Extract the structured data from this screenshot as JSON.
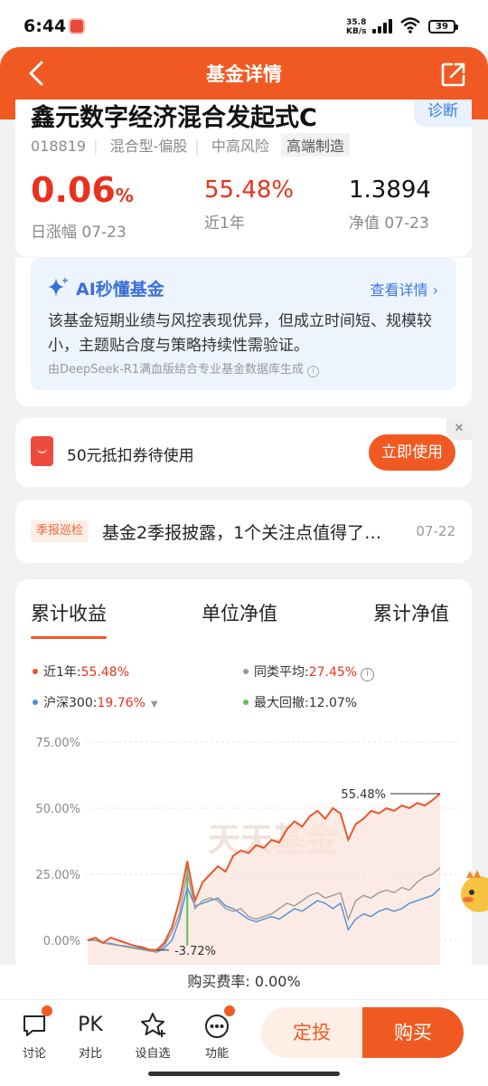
{
  "status_bar": {
    "time": "6:44",
    "net_speed": "35.8",
    "net_unit": "KB/s",
    "battery": "39"
  },
  "header": {
    "title": "基金详情"
  },
  "fund": {
    "name": "鑫元数字经济混合发起式C",
    "diagnose_label": "诊断",
    "code": "018819",
    "type": "混合型-偏股",
    "risk": "中高风险",
    "theme": "高端制造",
    "daily_change": "0.06",
    "daily_change_unit": "%",
    "daily_label": "日涨幅 07-23",
    "year_return": "55.48%",
    "year_label": "近1年",
    "nav": "1.3894",
    "nav_label": "净值 07-23"
  },
  "ai": {
    "title": "AI秒懂基金",
    "link": "查看详情",
    "text": "该基金短期业绩与风控表现优异，但成立时间短、规模较小，主题贴合度与策略持续性需验证。",
    "source": "由DeepSeek-R1满血版结合专业基金数据库生成"
  },
  "coupon": {
    "text": "50元抵扣券待使用",
    "button": "立即使用",
    "close": "✕"
  },
  "news": {
    "tag": "季报巡检",
    "title": "基金2季报披露，1个关注点值得了…",
    "date": "07-22"
  },
  "chart_tabs": [
    "累计收益",
    "单位净值",
    "累计净值"
  ],
  "legend": {
    "fund_label": "近1年:",
    "fund_value": "55.48%",
    "peer_label": "同类平均:",
    "peer_value": "27.45%",
    "index_label": "沪深300:",
    "index_value": "19.76%",
    "drawdown_label": "最大回撤:",
    "drawdown_value": "12.07%"
  },
  "colors": {
    "fund": "#e8562a",
    "peer": "#999999",
    "index": "#4a8fe0",
    "drawdown": "#5cc15a",
    "accent": "#f05a22"
  },
  "chart_data": {
    "type": "line",
    "y_ticks": [
      "75.00%",
      "50.00%",
      "25.00%",
      "0.00%"
    ],
    "ylim": [
      -10,
      75
    ],
    "watermark": "天天基金",
    "annotations": {
      "max": "55.48%",
      "min": "-3.72%"
    },
    "series": [
      {
        "name": "近1年",
        "values": [
          0,
          1,
          -1,
          1,
          0,
          -1,
          -2,
          -2.5,
          -3.5,
          -3.7,
          -1,
          5,
          15,
          30,
          15,
          22,
          25,
          28,
          26,
          32,
          34,
          33,
          36,
          35,
          38,
          37,
          42,
          45,
          43,
          47,
          49,
          46,
          50,
          48,
          38,
          44,
          46,
          49,
          48,
          50,
          49,
          51,
          50,
          52,
          51,
          53,
          55.5
        ]
      },
      {
        "name": "同类平均",
        "values": [
          0,
          0,
          -1,
          -1.5,
          -2,
          -2.5,
          -3,
          -3.5,
          -4,
          -4.5,
          -2,
          3,
          10,
          26,
          12,
          15,
          16,
          15,
          12,
          11,
          12,
          9,
          8,
          9,
          10,
          12,
          14,
          13,
          15,
          17,
          18,
          16,
          17,
          18,
          8,
          15,
          17,
          16,
          18,
          19,
          18,
          20,
          19,
          22,
          24,
          25,
          27.45
        ]
      },
      {
        "name": "沪深300",
        "values": [
          0,
          0,
          -1,
          -1.2,
          -1.8,
          -2.2,
          -2.8,
          -3,
          -3.8,
          -4.5,
          -3,
          0,
          8,
          20,
          13,
          14,
          15,
          16,
          13,
          12,
          10,
          8,
          7,
          8,
          9,
          8,
          10,
          12,
          11,
          13,
          15,
          14,
          12,
          14,
          4,
          8,
          10,
          9,
          11,
          12,
          11,
          12,
          14,
          15,
          16,
          17,
          19.76
        ]
      }
    ]
  },
  "fee": "购买费率: 0.00%",
  "bottom_nav": [
    "讨论",
    "对比",
    "设自选",
    "功能"
  ],
  "bottom_pk": "PK",
  "actions": {
    "dingtou": "定投",
    "buy": "购买"
  }
}
